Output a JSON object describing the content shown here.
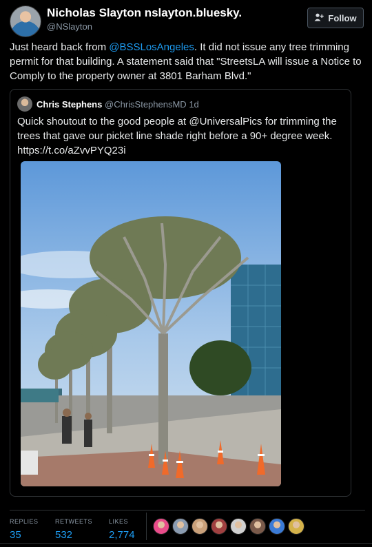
{
  "tweet": {
    "author_name": "Nicholas Slayton nslayton.bluesky.",
    "author_handle": "@NSlayton",
    "follow_label": "Follow",
    "text_before": "Just heard back from ",
    "mention": "@BSSLosAngeles",
    "text_after": ". It did not issue any tree trimming permit for that building. A statement said that \"StreetsLA will issue a Notice to Comply to the property owner at 3801 Barham Blvd.\""
  },
  "quote": {
    "author_name": "Chris Stephens",
    "author_handle": "@ChrisStephensMD",
    "time": "1d",
    "text": "Quick shoutout to the good people at @UniversalPics for trimming the trees that gave our picket line shade right before a 90+ degree week. https://t.co/aZvvPYQ23i"
  },
  "stats": {
    "replies_label": "REPLIES",
    "replies_value": "35",
    "retweets_label": "RETWEETS",
    "retweets_value": "532",
    "likes_label": "LIKES",
    "likes_value": "2,774"
  },
  "likers": [
    "#e94c8a",
    "#8a9bb0",
    "#c9a07a",
    "#a04040",
    "#d0d0d0",
    "#7a5a4a",
    "#3b7bd6",
    "#d4b24a"
  ],
  "icons": {
    "follow": "add-user-icon"
  }
}
